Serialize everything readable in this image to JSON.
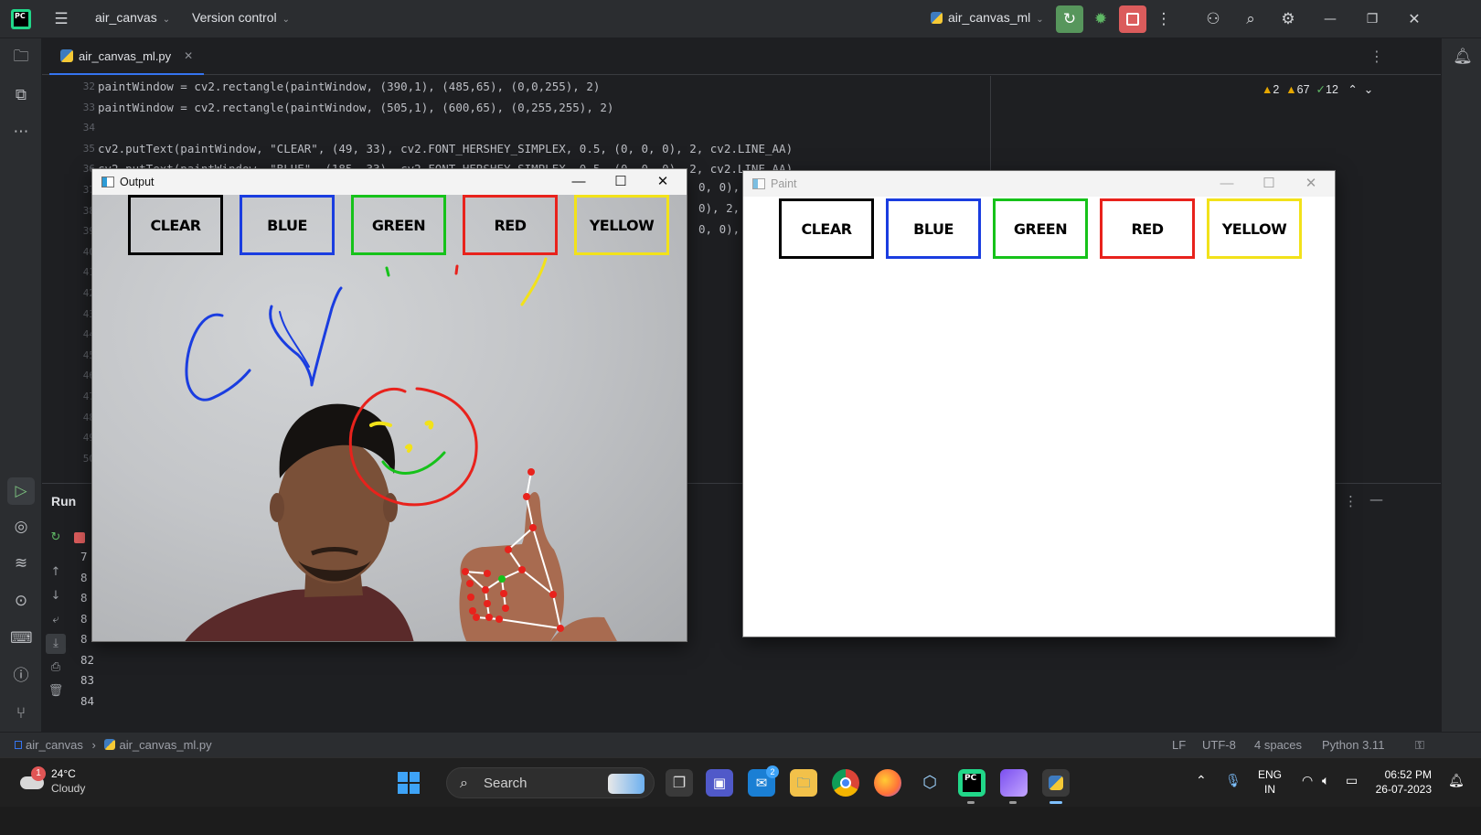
{
  "title_bar": {
    "project": "air_canvas",
    "vcs": "Version control",
    "run_config": "air_canvas_ml"
  },
  "editor": {
    "tab_name": "air_canvas_ml.py",
    "inspections": {
      "warn1": "2",
      "warn2": "67",
      "ok": "12"
    },
    "lines": [
      {
        "n": "32",
        "code": "paintWindow = cv2.rectangle(paintWindow, (390,1), (485,65), (0,0,255), 2)"
      },
      {
        "n": "33",
        "code": "paintWindow = cv2.rectangle(paintWindow, (505,1), (600,65), (0,255,255), 2)"
      },
      {
        "n": "34",
        "code": ""
      },
      {
        "n": "35",
        "code": "cv2.putText(paintWindow, \"CLEAR\", (49, 33), cv2.FONT_HERSHEY_SIMPLEX, 0.5, (0, 0, 0), 2, cv2.LINE_AA)"
      },
      {
        "n": "36",
        "code": "cv2.putText(paintWindow, \"BLUE\", (185, 33), cv2.FONT_HERSHEY_SIMPLEX, 0.5, (0, 0, 0), 2, cv2.LINE_AA)"
      },
      {
        "n": "37",
        "code": ""
      },
      {
        "n": "38",
        "code": ""
      },
      {
        "n": "39",
        "code": ""
      },
      {
        "n": "40",
        "code": ""
      },
      {
        "n": "41",
        "code": ""
      },
      {
        "n": "42",
        "code": ""
      },
      {
        "n": "43",
        "code": ""
      },
      {
        "n": "44",
        "code": ""
      },
      {
        "n": "45",
        "code": ""
      },
      {
        "n": "46",
        "code": ""
      },
      {
        "n": "47",
        "code": ""
      },
      {
        "n": "48",
        "code": ""
      },
      {
        "n": "49",
        "code": ""
      },
      {
        "n": "50",
        "code": ""
      }
    ],
    "visible_tails": [
      "0, 0),",
      "0), 2,",
      "0, 0),"
    ]
  },
  "run_panel": {
    "title": "Run",
    "output_lines": [
      "7",
      "8",
      "8",
      "8",
      "8",
      "82",
      "83",
      "84"
    ]
  },
  "status_bar": {
    "crumb_project": "air_canvas",
    "crumb_file": "air_canvas_ml.py",
    "line_sep": "LF",
    "encoding": "UTF-8",
    "indent": "4 spaces",
    "interpreter": "Python 3.11"
  },
  "output_window": {
    "title": "Output",
    "buttons": [
      "CLEAR",
      "BLUE",
      "GREEN",
      "RED",
      "YELLOW"
    ]
  },
  "paint_window": {
    "title": "Paint",
    "buttons": [
      "CLEAR",
      "BLUE",
      "GREEN",
      "RED",
      "YELLOW"
    ]
  },
  "palette": {
    "clear": "#000000",
    "blue": "#1a3de0",
    "green": "#16c21a",
    "red": "#e8221c",
    "yellow": "#f2e21a",
    "ide_bg": "#1e1f22",
    "accent": "#3574f0"
  },
  "taskbar": {
    "weather_temp": "24°C",
    "weather_desc": "Cloudy",
    "weather_badge": "1",
    "search": "Search",
    "teams_badge": "2",
    "lang": "ENG",
    "region": "IN",
    "time": "06:52 PM",
    "date": "26-07-2023"
  }
}
